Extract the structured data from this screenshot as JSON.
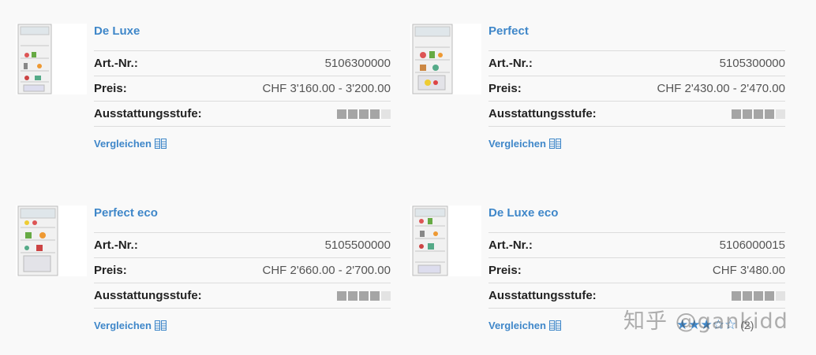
{
  "products": [
    {
      "title": "De Luxe",
      "art_label": "Art.-Nr.:",
      "art_nr": "5106300000",
      "price_label": "Preis:",
      "price": "CHF 3'160.00 - 3'200.00",
      "level_label": "Ausstattungsstufe:",
      "level": 4,
      "level_max": 5,
      "compare": "Vergleichen"
    },
    {
      "title": "Perfect",
      "art_label": "Art.-Nr.:",
      "art_nr": "5105300000",
      "price_label": "Preis:",
      "price": "CHF 2'430.00 - 2'470.00",
      "level_label": "Ausstattungsstufe:",
      "level": 4,
      "level_max": 5,
      "compare": "Vergleichen"
    },
    {
      "title": "Perfect eco",
      "art_label": "Art.-Nr.:",
      "art_nr": "5105500000",
      "price_label": "Preis:",
      "price": "CHF 2'660.00 - 2'700.00",
      "level_label": "Ausstattungsstufe:",
      "level": 4,
      "level_max": 5,
      "compare": "Vergleichen"
    },
    {
      "title": "De Luxe eco",
      "art_label": "Art.-Nr.:",
      "art_nr": "5106000015",
      "price_label": "Preis:",
      "price": "CHF 3'480.00",
      "level_label": "Ausstattungsstufe:",
      "level": 4,
      "level_max": 5,
      "compare": "Vergleichen"
    }
  ],
  "rating": {
    "value": 3,
    "max": 5,
    "count": "(2)"
  },
  "watermark": "知乎 @gankidd",
  "colors": {
    "link": "#3f87c9",
    "level_on": "#a5a5a5",
    "level_off": "#e3e3e3"
  },
  "icons": {
    "compare": "compare-icon",
    "product": "fridge-image"
  }
}
